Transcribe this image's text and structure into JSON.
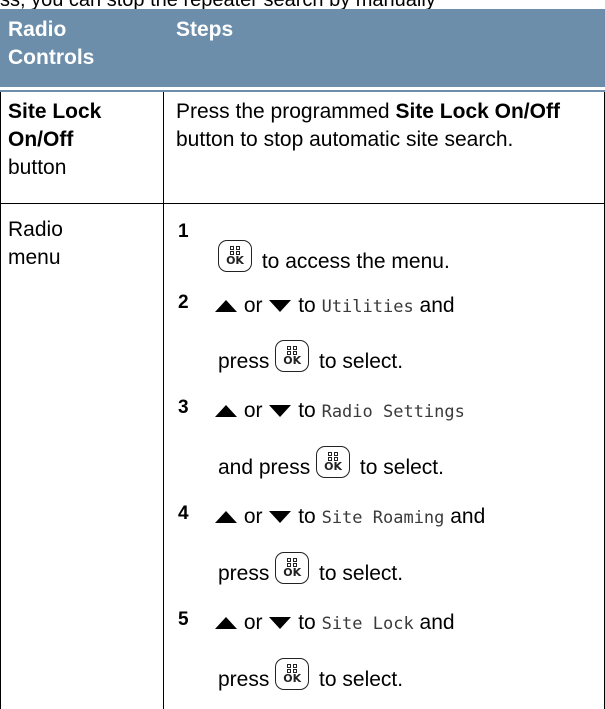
{
  "page": {
    "top_fragment": "ss, you can stop the repeater search by manually"
  },
  "table": {
    "headers": [
      "Radio Controls",
      "Steps"
    ],
    "rows": [
      {
        "control": [
          "Site Lock",
          "On/Off",
          "button"
        ],
        "steps_text": {
          "pre": "Press the programmed ",
          "bold": "Site Lock On/Off",
          "post": " button to stop automatic site search."
        }
      },
      {
        "control": [
          "Radio",
          "menu"
        ],
        "steps": [
          {
            "num": "1",
            "line1": "to access the menu."
          },
          {
            "num": "2",
            "or": "or",
            "to": "to",
            "menu_item": "Utilities",
            "and": "and",
            "press": "press",
            "select": "to select."
          },
          {
            "num": "3",
            "or": "or",
            "to": "to",
            "menu_item": "Radio Settings",
            "and_press": "and press",
            "select": "to select."
          },
          {
            "num": "4",
            "or": "or",
            "to": "to",
            "menu_item": "Site Roaming",
            "and": "and",
            "press": "press",
            "select": "to select."
          },
          {
            "num": "5",
            "or": "or",
            "to": "to",
            "menu_item": "Site Lock",
            "and": "and",
            "press": "press",
            "select": "to select."
          }
        ]
      }
    ]
  },
  "icons": {
    "ok_button": "menu-ok-button-icon",
    "up": "up-arrow-icon",
    "down": "down-arrow-icon",
    "ok_label": "OK"
  },
  "colors": {
    "header_bg": "#6c8eab",
    "mono_text": "#3a3a3a"
  }
}
